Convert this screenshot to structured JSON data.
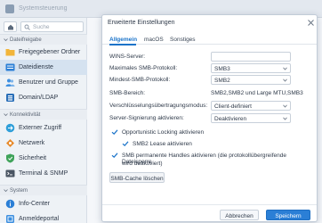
{
  "window": {
    "title": "Systemsteuerung"
  },
  "sidebar": {
    "search_placeholder": "Suche",
    "sections": [
      {
        "label": "Dateifreigabe",
        "items": [
          {
            "label": "Freigegebener Ordner",
            "icon": "shared-folder-icon",
            "active": false
          },
          {
            "label": "Dateidienste",
            "icon": "file-services-icon",
            "active": true
          },
          {
            "label": "Benutzer und Gruppe",
            "icon": "users-icon",
            "active": false
          },
          {
            "label": "Domain/LDAP",
            "icon": "domain-icon",
            "active": false
          }
        ]
      },
      {
        "label": "Konnektivität",
        "items": [
          {
            "label": "Externer Zugriff",
            "icon": "external-access-icon",
            "active": false
          },
          {
            "label": "Netzwerk",
            "icon": "network-icon",
            "active": false
          },
          {
            "label": "Sicherheit",
            "icon": "security-icon",
            "active": false
          },
          {
            "label": "Terminal & SNMP",
            "icon": "terminal-icon",
            "active": false
          }
        ]
      },
      {
        "label": "System",
        "items": [
          {
            "label": "Info-Center",
            "icon": "info-icon",
            "active": false
          },
          {
            "label": "Anmeldeportal",
            "icon": "login-portal-icon",
            "active": false
          }
        ]
      }
    ]
  },
  "dialog": {
    "title": "Erweiterte Einstellungen",
    "tabs": [
      "Allgemein",
      "macOS",
      "Sonstiges"
    ],
    "active_tab": "Allgemein",
    "fields": {
      "wins_label": "WINS-Server:",
      "wins_value": "",
      "max_smb_label": "Maximales SMB-Protokoll:",
      "max_smb_value": "SMB3",
      "min_smb_label": "Mindest-SMB-Protokoll:",
      "min_smb_value": "SMB2",
      "smb_range_label": "SMB-Bereich:",
      "smb_range_value": "SMB2,SMB2 und Large MTU,SMB3",
      "encryption_label": "Verschlüsselungsübertragungsmodus:",
      "encryption_value": "Client-definiert",
      "signing_label": "Server-Signierung aktivieren:",
      "signing_value": "Deaktivieren"
    },
    "checkboxes": {
      "oplock_label": "Opportunistic Locking aktivieren",
      "oplock_checked": true,
      "lease_label": "SMB2 Lease aktivieren",
      "lease_checked": true,
      "durable_label_line1": "SMB permanente Handles aktivieren (die protokollübergreifende Dateisperre",
      "durable_label_line2": "wird deaktiviert)",
      "durable_checked": true
    },
    "cache_button": "SMB-Cache löschen",
    "cancel_button": "Abbrechen",
    "save_button": "Speichern"
  },
  "colors": {
    "accent": "#1a73c9",
    "primary_button": "#2b7fd6",
    "active_nav_bg": "#d5e2f0"
  }
}
